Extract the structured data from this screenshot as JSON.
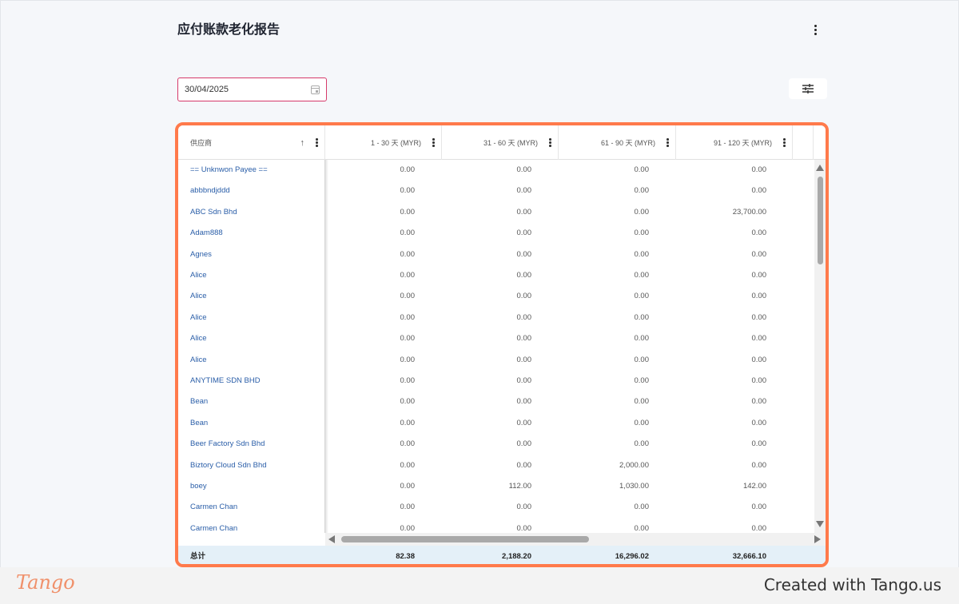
{
  "page": {
    "title": "应付账款老化报告"
  },
  "filters": {
    "date_value": "30/04/2025"
  },
  "grid": {
    "columns": [
      {
        "label": "供应商"
      },
      {
        "label": "1 - 30 天 (MYR)"
      },
      {
        "label": "31 - 60 天 (MYR)"
      },
      {
        "label": "61 - 90 天 (MYR)"
      },
      {
        "label": "91 - 120 天 (MYR)"
      }
    ],
    "rows": [
      {
        "supplier": "== Unknwon Payee ==",
        "d1_30": "0.00",
        "d31_60": "0.00",
        "d61_90": "0.00",
        "d91_120": "0.00"
      },
      {
        "supplier": "abbbndjddd",
        "d1_30": "0.00",
        "d31_60": "0.00",
        "d61_90": "0.00",
        "d91_120": "0.00"
      },
      {
        "supplier": "ABC Sdn Bhd",
        "d1_30": "0.00",
        "d31_60": "0.00",
        "d61_90": "0.00",
        "d91_120": "23,700.00"
      },
      {
        "supplier": "Adam888",
        "d1_30": "0.00",
        "d31_60": "0.00",
        "d61_90": "0.00",
        "d91_120": "0.00"
      },
      {
        "supplier": "Agnes",
        "d1_30": "0.00",
        "d31_60": "0.00",
        "d61_90": "0.00",
        "d91_120": "0.00"
      },
      {
        "supplier": "Alice",
        "d1_30": "0.00",
        "d31_60": "0.00",
        "d61_90": "0.00",
        "d91_120": "0.00"
      },
      {
        "supplier": "Alice",
        "d1_30": "0.00",
        "d31_60": "0.00",
        "d61_90": "0.00",
        "d91_120": "0.00"
      },
      {
        "supplier": "Alice",
        "d1_30": "0.00",
        "d31_60": "0.00",
        "d61_90": "0.00",
        "d91_120": "0.00"
      },
      {
        "supplier": "Alice",
        "d1_30": "0.00",
        "d31_60": "0.00",
        "d61_90": "0.00",
        "d91_120": "0.00"
      },
      {
        "supplier": "Alice",
        "d1_30": "0.00",
        "d31_60": "0.00",
        "d61_90": "0.00",
        "d91_120": "0.00"
      },
      {
        "supplier": "ANYTIME SDN BHD",
        "d1_30": "0.00",
        "d31_60": "0.00",
        "d61_90": "0.00",
        "d91_120": "0.00"
      },
      {
        "supplier": "Bean",
        "d1_30": "0.00",
        "d31_60": "0.00",
        "d61_90": "0.00",
        "d91_120": "0.00"
      },
      {
        "supplier": "Bean",
        "d1_30": "0.00",
        "d31_60": "0.00",
        "d61_90": "0.00",
        "d91_120": "0.00"
      },
      {
        "supplier": "Beer Factory Sdn Bhd",
        "d1_30": "0.00",
        "d31_60": "0.00",
        "d61_90": "0.00",
        "d91_120": "0.00"
      },
      {
        "supplier": "Biztory Cloud Sdn Bhd",
        "d1_30": "0.00",
        "d31_60": "0.00",
        "d61_90": "2,000.00",
        "d91_120": "0.00"
      },
      {
        "supplier": "boey",
        "d1_30": "0.00",
        "d31_60": "112.00",
        "d61_90": "1,030.00",
        "d91_120": "142.00"
      },
      {
        "supplier": "Carmen Chan",
        "d1_30": "0.00",
        "d31_60": "0.00",
        "d61_90": "0.00",
        "d91_120": "0.00"
      },
      {
        "supplier": "Carmen Chan",
        "d1_30": "0.00",
        "d31_60": "0.00",
        "d61_90": "0.00",
        "d91_120": "0.00"
      }
    ],
    "totals": {
      "label": "总计",
      "d1_30": "82.38",
      "d31_60": "2,188.20",
      "d61_90": "16,296.02",
      "d91_120": "32,666.10"
    }
  },
  "footer": {
    "logo": "Tango",
    "credit": "Created with Tango.us"
  }
}
